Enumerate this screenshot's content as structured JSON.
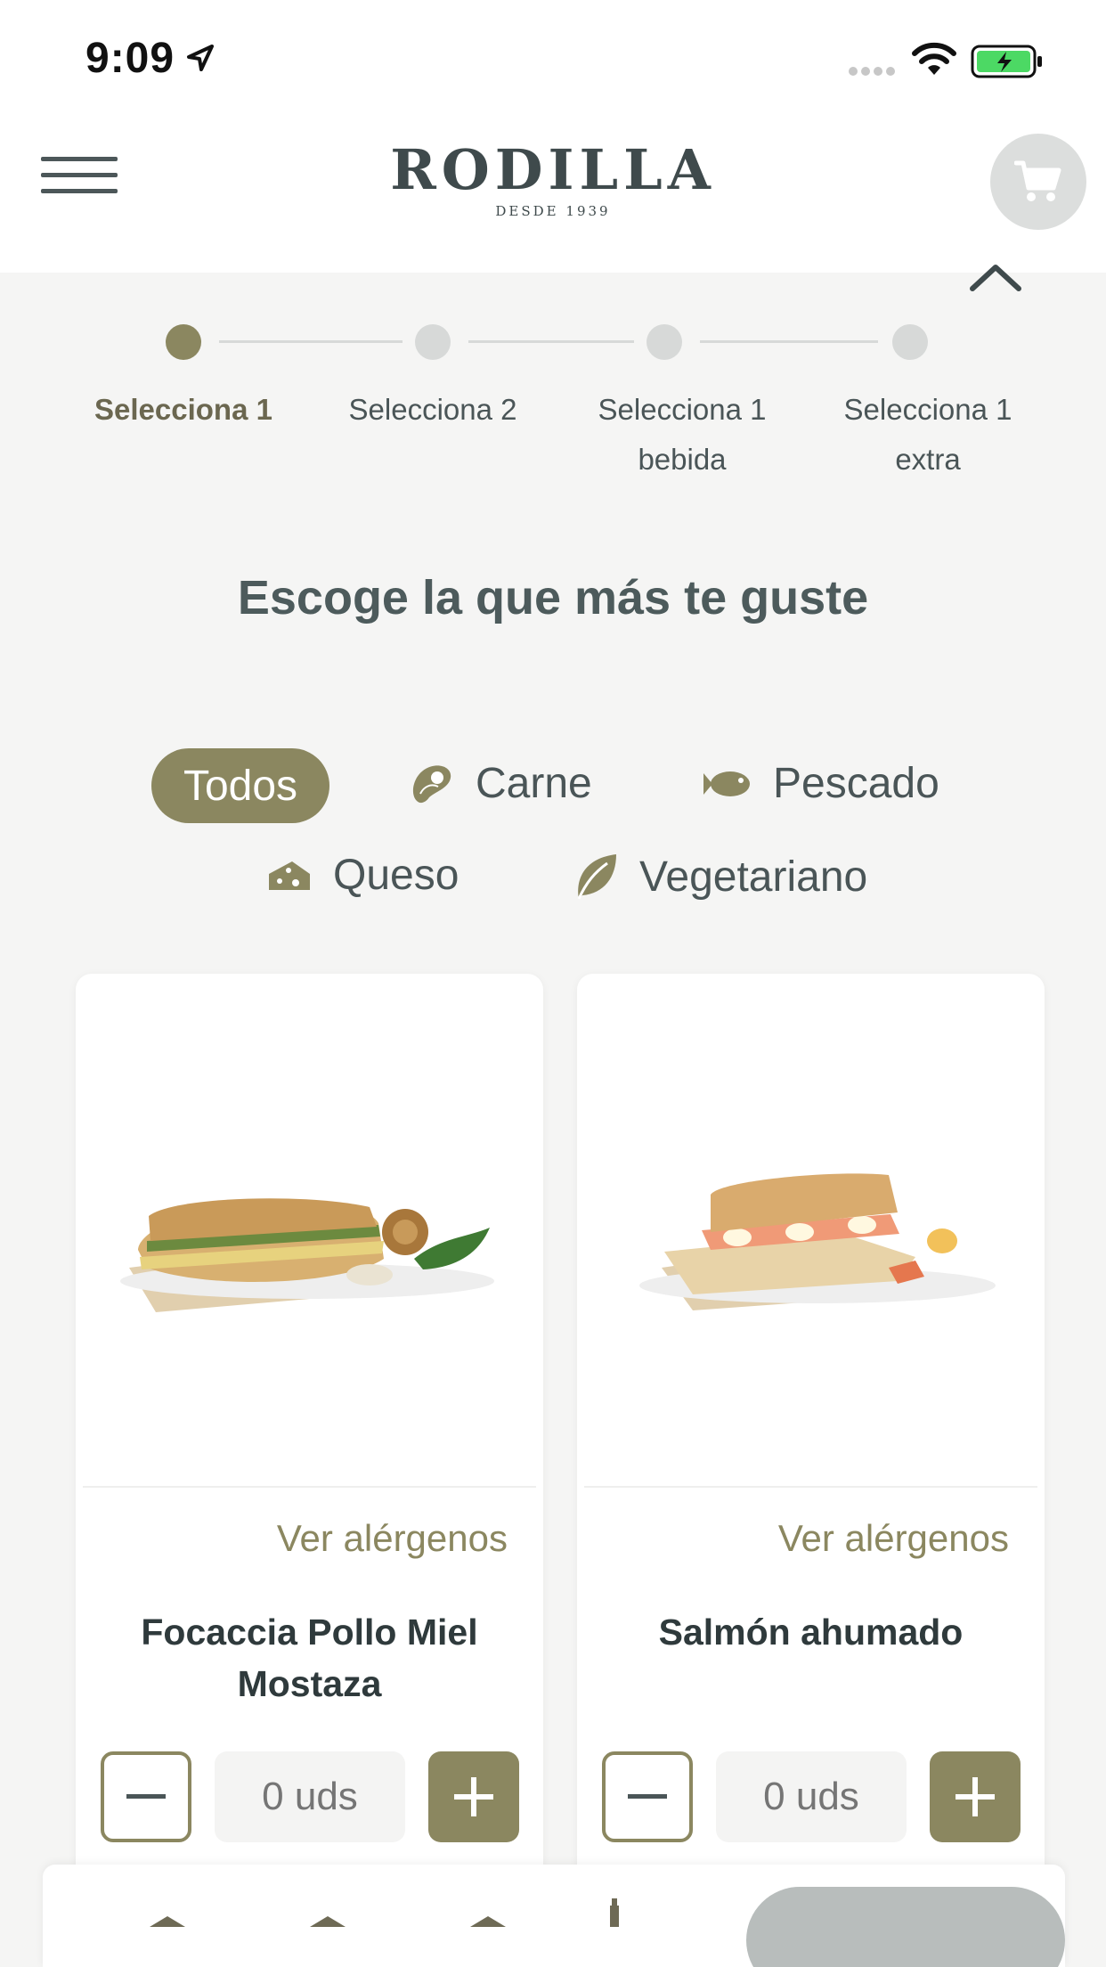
{
  "status_bar": {
    "time": "9:09"
  },
  "header": {
    "brand": "RODILLA",
    "brand_sub": "DESDE 1939"
  },
  "stepper": {
    "steps": [
      {
        "label": "Selecciona 1",
        "active": true
      },
      {
        "label": "Selecciona 2",
        "active": false
      },
      {
        "label": "Selecciona 1\nbebida",
        "active": false
      },
      {
        "label": "Selecciona 1\nextra",
        "active": false
      }
    ]
  },
  "subtitle": "Escoge la que más te guste",
  "filters": {
    "all": "Todos",
    "meat": "Carne",
    "fish": "Pescado",
    "cheese": "Queso",
    "veg": "Vegetariano"
  },
  "products": [
    {
      "allergens_link": "Ver alérgenos",
      "name": "Focaccia Pollo Miel Mostaza",
      "qty_placeholder": "0 uds"
    },
    {
      "allergens_link": "Ver alérgenos",
      "name": "Salmón ahumado",
      "qty_placeholder": "0 uds"
    }
  ],
  "colors": {
    "accent": "#8b8760",
    "text": "#3f4a4c",
    "background": "#f5f5f4"
  },
  "icons": {
    "menu": "hamburger-icon",
    "cart": "cart-icon",
    "close": "chevron-up-icon",
    "meat": "meat-icon",
    "fish": "fish-icon",
    "cheese": "cheese-icon",
    "veg": "leaf-icon"
  }
}
